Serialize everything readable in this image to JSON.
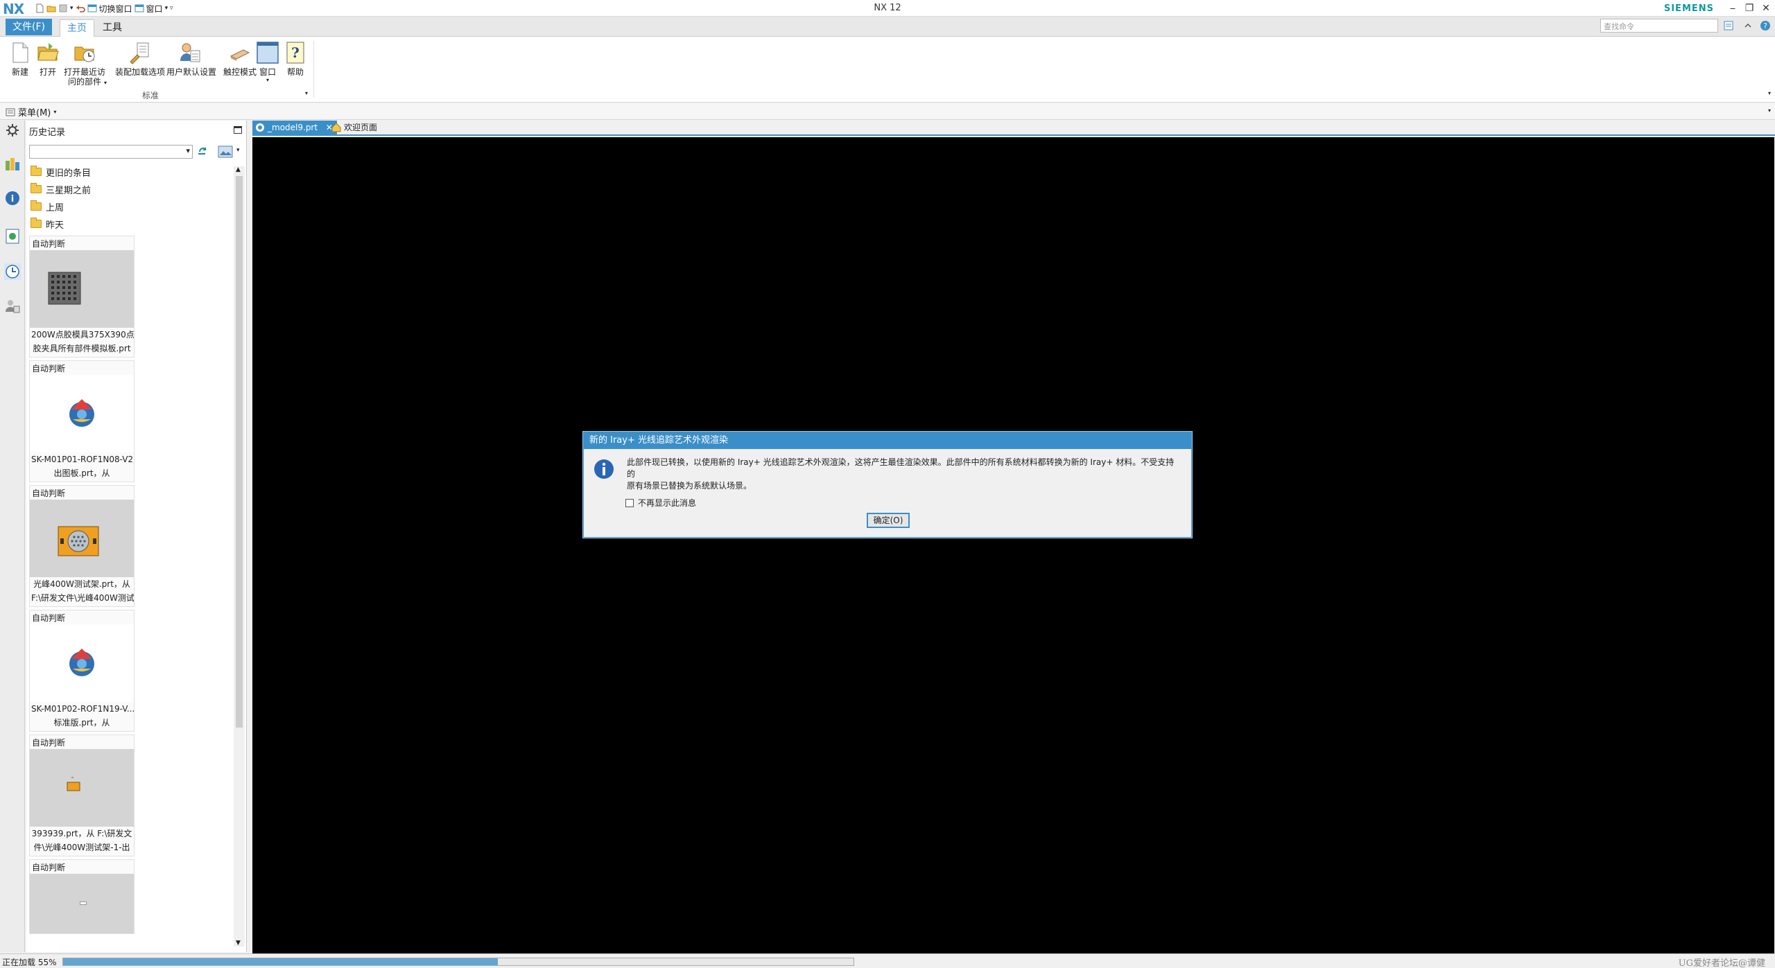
{
  "titlebar": {
    "logo": "NX",
    "switch_window": "切换窗口",
    "window_menu": "窗口",
    "app_title": "NX 12",
    "brand": "SIEMENS",
    "minimize": "⎯",
    "restore": "❐",
    "close": "✕"
  },
  "ribbon_tabs": {
    "file": "文件(F)",
    "home": "主页",
    "tools": "工具",
    "search_placeholder": "查找命令"
  },
  "ribbon": {
    "buttons": {
      "new": "新建",
      "open": "打开",
      "recent_1": "打开最近访",
      "recent_2": "问的部件",
      "assembly_load": "装配加载选项",
      "user_defaults": "用户默认设置",
      "touch_mode": "触控模式",
      "window": "窗口",
      "help": "帮助"
    },
    "group_label": "标准"
  },
  "menubar": {
    "menu": "菜单(M)"
  },
  "history": {
    "title": "历史记录",
    "folders": [
      "更旧的条目",
      "三星期之前",
      "上周",
      "昨天"
    ],
    "cards": [
      {
        "head": "自动判断",
        "line1": "200W点胶模具375X390点",
        "line2": "胶夹具所有部件模拟板.prt"
      },
      {
        "head": "自动判断",
        "line1": "SK-M01P01-ROF1N08-V2",
        "line2": "出图板.prt，从"
      },
      {
        "head": "自动判断",
        "line1": "光峰400W测试架.prt，从",
        "line2": "F:\\研发文件\\光峰400W测试"
      },
      {
        "head": "自动判断",
        "line1": "SK-M01P02-ROF1N19-V...",
        "line2": "标准版.prt，从"
      },
      {
        "head": "自动判断",
        "line1": "393939.prt，从 F:\\研发文",
        "line2": "件\\光峰400W测试架-1-出"
      },
      {
        "head": "自动判断",
        "line1": "",
        "line2": ""
      }
    ]
  },
  "doc_tabs": [
    {
      "label": "_model9.prt",
      "close": "✕"
    },
    {
      "label": "欢迎页面"
    }
  ],
  "dialog": {
    "title": "新的 Iray+ 光线追踪艺术外观渲染",
    "message_line1": "此部件现已转换，以使用新的 Iray+ 光线追踪艺术外观渲染，这将产生最佳渲染效果。此部件中的所有系统材料都转换为新的 Iray+ 材料。不受支持的",
    "message_line2": "原有场景已替换为系统默认场景。",
    "checkbox_label": "不再显示此消息",
    "ok_button": "确定(O)"
  },
  "status": {
    "text": "正在加载 55%",
    "progress": 0.55,
    "watermark": "UG爱好者论坛@谭健"
  },
  "colors": {
    "accent": "#3b8fc9",
    "brand": "#0d9a9e",
    "graphics_bg": "#000000"
  }
}
